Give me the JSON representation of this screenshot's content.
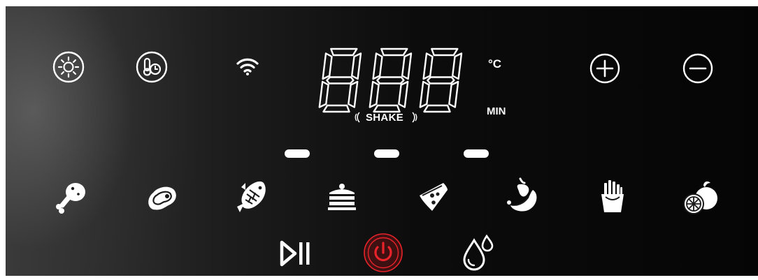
{
  "display": {
    "digits": "888",
    "unit_celsius": "°C",
    "unit_minutes": "MIN",
    "shake_label": "SHAKE"
  },
  "controls": {
    "top": [
      "light-icon",
      "temperature-timer-icon",
      "wifi-icon",
      "plus-icon",
      "minus-icon"
    ],
    "presets": [
      "chicken-drumstick-icon",
      "steak-icon",
      "fish-icon",
      "cake-icon",
      "pizza-icon",
      "sausage-icon",
      "french-fries-icon",
      "fruit-icon"
    ],
    "bottom": [
      "play-pause-icon",
      "power-icon",
      "dehydrate-icon"
    ]
  },
  "colors": {
    "panel_dark": "#050505",
    "icon": "#ffffff",
    "power_accent": "#e8232a"
  }
}
